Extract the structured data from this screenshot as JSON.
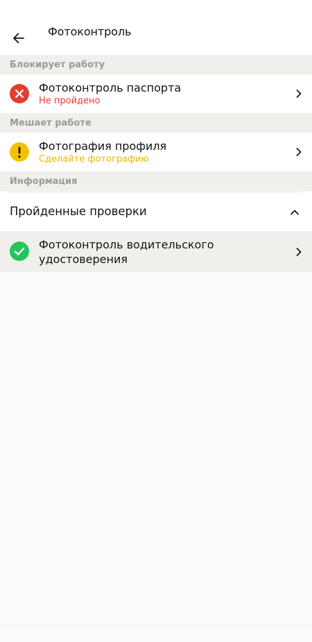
{
  "header": {
    "title": "Фотоконтроль"
  },
  "sections": {
    "blocking": {
      "label": "Блокирует работу",
      "item": {
        "title": "Фотоконтроль паспорта",
        "status": "Не пройдено",
        "status_color": "#e53c32",
        "icon": "error-cross-icon"
      }
    },
    "interfering": {
      "label": "Мешает работе",
      "item": {
        "title": "Фотография профиля",
        "status": "Сделайте фотографию",
        "status_color": "#f5c200",
        "icon": "warning-exclamation-icon"
      }
    },
    "info": {
      "label": "Информация"
    }
  },
  "passed": {
    "label": "Пройденные проверки",
    "expanded": true,
    "items": [
      {
        "title_line1": "Фотоконтроль водительского",
        "title_line2": "удостоверения",
        "status_color": "#24c55a",
        "icon": "check-icon"
      }
    ]
  }
}
